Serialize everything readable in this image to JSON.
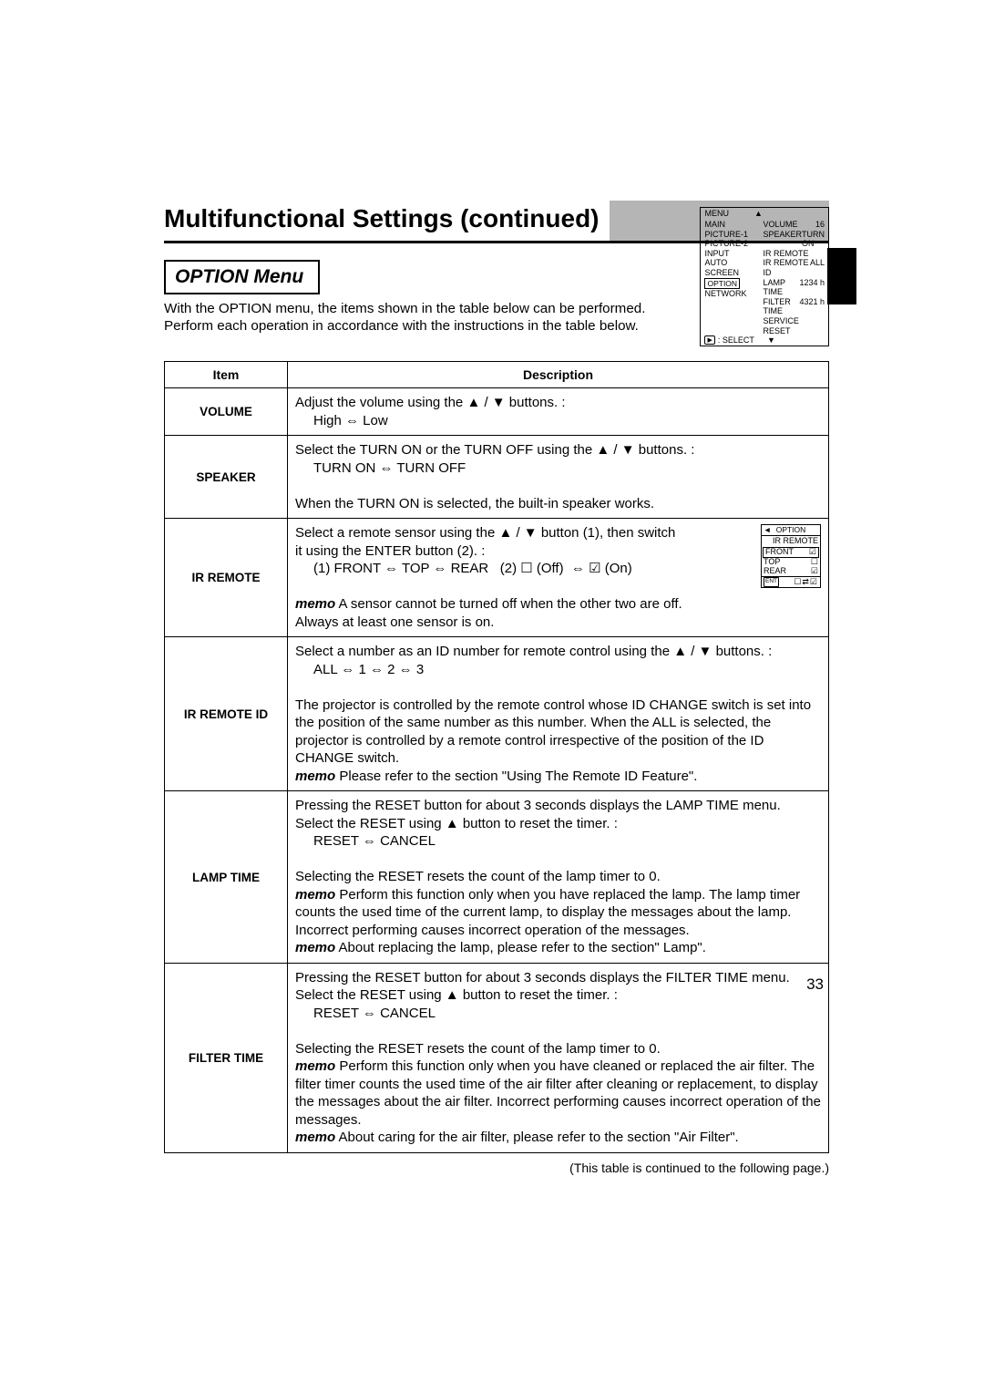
{
  "page": {
    "title": "Multifunctional Settings (continued)",
    "number": "33"
  },
  "section": {
    "header": "OPTION Menu",
    "intro": "With the  OPTION menu, the items shown in the table below can be performed. Perform each operation in accordance with the instructions in the table below."
  },
  "osd": {
    "menu_label": "MENU",
    "left": [
      "MAIN",
      "PICTURE-1",
      "PICTURE-2",
      "INPUT",
      "AUTO",
      "SCREEN",
      "OPTION",
      "NETWORK"
    ],
    "selected_index": 6,
    "right": [
      {
        "label": "VOLUME",
        "value": "16"
      },
      {
        "label": "SPEAKER",
        "value": "TURN ON"
      },
      {
        "label": "IR REMOTE",
        "value": ""
      },
      {
        "label": "IR REMOTE ID",
        "value": "ALL"
      },
      {
        "label": "LAMP TIME",
        "value": "1234 h"
      },
      {
        "label": "FILTER TIME",
        "value": "4321 h"
      },
      {
        "label": "SERVICE",
        "value": ""
      },
      {
        "label": "RESET",
        "value": ""
      }
    ],
    "select_label": ": SELECT",
    "nav_key": "▶"
  },
  "ir_popup": {
    "header": "OPTION",
    "title": "IR REMOTE",
    "rows": [
      {
        "label": "FRONT",
        "state": "☑"
      },
      {
        "label": "TOP",
        "state": "☐"
      },
      {
        "label": "REAR",
        "state": "☑"
      }
    ],
    "ent": "ENT",
    "sqs": "☐⇄☑"
  },
  "table": {
    "headers": {
      "item": "Item",
      "desc": "Description"
    },
    "rows": [
      {
        "item": "VOLUME",
        "desc_lines": [
          "Adjust the volume using the  ▲ / ▼ buttons. :",
          "<span class=\"indent\">High ⇔ Low</span>"
        ]
      },
      {
        "item": "SPEAKER",
        "desc_lines": [
          "Select the TURN ON or the TURN OFF using the  ▲ / ▼ buttons. :",
          "<span class=\"indent\">TURN ON ⇔ TURN OFF</span>",
          "When the TURN ON is selected, the built-in speaker works."
        ]
      },
      {
        "item": "IR REMOTE",
        "has_popup": true,
        "desc_lines": [
          "Select a remote sensor using the  ▲ / ▼ button (1), then switch",
          "it using the ENTER button (2). :",
          "<span class=\"indent\">(1) FRONT ⇔ TOP ⇔ REAR&nbsp;&nbsp;&nbsp;(2) ☐ (Off)&nbsp;&nbsp;⇔ ☑ (On)</span>",
          "<span class=\"memo\">memo</span> A sensor cannot be turned off when the other two are off.",
          "Always at least one sensor is on."
        ]
      },
      {
        "item": "IR REMOTE ID",
        "desc_lines": [
          "Select a number as an ID number for remote control using the  ▲ / ▼ buttons. :",
          "<span class=\"indent\">ALL ⇔ 1 ⇔ 2 ⇔ 3</span>",
          "The projector is controlled by the remote control whose ID CHANGE switch is set into the position of the same number as this number. When the ALL is selected, the projector is controlled by a remote control irrespective of the position of the ID CHANGE switch.",
          "<span class=\"memo\">memo</span> Please refer to the section \"Using The Remote ID Feature\"."
        ]
      },
      {
        "item": "LAMP TIME",
        "desc_lines": [
          "Pressing the RESET button for about 3 seconds displays the LAMP TIME menu.",
          "Select the RESET using  ▲ button to reset the timer. :",
          "<span class=\"indent\">RESET ⇔ CANCEL</span>",
          "Selecting the RESET resets the count of the lamp timer to 0.",
          "<span class=\"memo\">memo</span> Perform this function only when you have replaced the lamp. The lamp timer counts the used time of the current lamp, to display the messages about the lamp. Incorrect performing causes incorrect operation of the messages.",
          "<span class=\"memo\">memo</span> About replacing the lamp, please refer to the section\" Lamp\"."
        ]
      },
      {
        "item": "FILTER TIME",
        "desc_lines": [
          "Pressing the RESET button for about 3 seconds displays the FILTER TIME menu.",
          "Select the RESET using  ▲ button to reset the timer. :",
          "<span class=\"indent\">RESET ⇔ CANCEL</span>",
          "Selecting the RESET resets the count of the lamp timer to 0.",
          "<span class=\"memo\">memo</span> Perform this function only when you have cleaned or replaced the air filter. The filter timer counts the used time of the air filter after cleaning or replacement, to display the messages about the air filter. Incorrect performing causes incorrect operation of the messages.",
          "<span class=\"memo\">memo</span> About caring for the air filter, please refer to the section \"Air Filter\"."
        ]
      }
    ],
    "footnote": "(This table is continued to the following page.)"
  }
}
